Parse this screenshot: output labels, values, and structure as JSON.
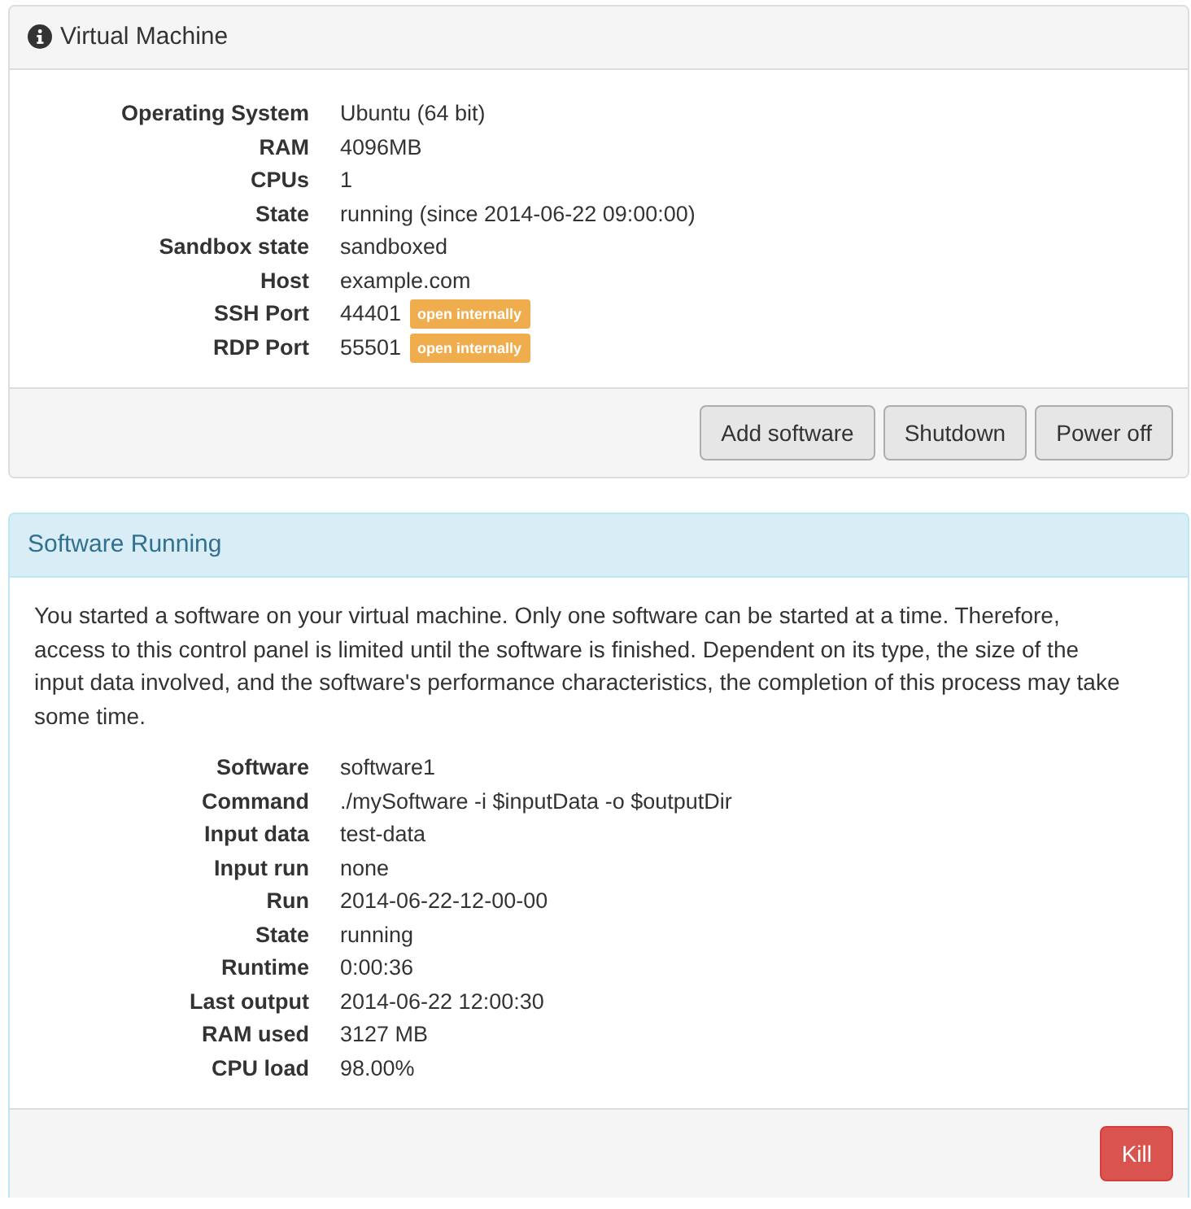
{
  "vm_panel": {
    "title": "Virtual Machine",
    "details": [
      {
        "label": "Operating System",
        "value": "Ubuntu (64 bit)"
      },
      {
        "label": "RAM",
        "value": "4096MB"
      },
      {
        "label": "CPUs",
        "value": "1"
      },
      {
        "label": "State",
        "value": "running (since 2014-06-22 09:00:00)"
      },
      {
        "label": "Sandbox state",
        "value": "sandboxed"
      },
      {
        "label": "Host",
        "value": "example.com"
      },
      {
        "label": "SSH Port",
        "value": "44401",
        "badge": "open internally"
      },
      {
        "label": "RDP Port",
        "value": "55501",
        "badge": "open internally"
      }
    ],
    "buttons": [
      {
        "label": "Add software",
        "kind": "default"
      },
      {
        "label": "Shutdown",
        "kind": "default"
      },
      {
        "label": "Power off",
        "kind": "default"
      }
    ]
  },
  "software_panel": {
    "title": "Software Running",
    "message": "You started a software on your virtual machine. Only one software can be started at a time. Therefore, access to this control panel is limited until the software is finished. Dependent on its type, the size of the input data involved, and the software's performance characteristics, the completion of this process may take some time.",
    "details": [
      {
        "label": "Software",
        "value": "software1"
      },
      {
        "label": "Command",
        "value": "./mySoftware -i $inputData -o $outputDir"
      },
      {
        "label": "Input data",
        "value": "test-data"
      },
      {
        "label": "Input run",
        "value": "none"
      },
      {
        "label": "Run",
        "value": "2014-06-22-12-00-00"
      },
      {
        "label": "State",
        "value": "running"
      },
      {
        "label": "Runtime",
        "value": "0:00:36"
      },
      {
        "label": "Last output",
        "value": "2014-06-22 12:00:30"
      },
      {
        "label": "RAM used",
        "value": "3127 MB"
      },
      {
        "label": "CPU load",
        "value": "98.00%"
      }
    ],
    "buttons": [
      {
        "label": "Kill",
        "kind": "danger"
      }
    ]
  }
}
